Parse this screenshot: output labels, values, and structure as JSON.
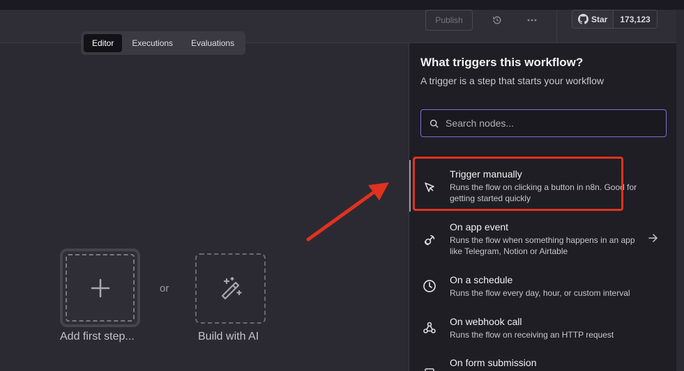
{
  "header": {
    "publish_label": "Publish",
    "history_icon": "history-icon",
    "more_icon": "more-horizontal-icon",
    "github": {
      "icon": "github-icon",
      "star_label": "Star",
      "star_count": "173,123"
    }
  },
  "tabs": [
    {
      "label": "Editor",
      "active": true
    },
    {
      "label": "Executions",
      "active": false
    },
    {
      "label": "Evaluations",
      "active": false
    }
  ],
  "canvas": {
    "add_first_step_label": "Add first step...",
    "or_label": "or",
    "build_ai_label": "Build with AI"
  },
  "panel": {
    "title": "What triggers this workflow?",
    "subtitle": "A trigger is a step that starts your workflow",
    "search": {
      "placeholder": "Search nodes...",
      "value": ""
    },
    "items": [
      {
        "icon": "cursor-icon",
        "name": "Trigger manually",
        "desc": "Runs the flow on clicking a button in n8n. Good for getting started quickly",
        "has_chevron": false
      },
      {
        "icon": "app-event-icon",
        "name": "On app event",
        "desc": "Runs the flow when something happens in an app like Telegram, Notion or Airtable",
        "has_chevron": true
      },
      {
        "icon": "clock-icon",
        "name": "On a schedule",
        "desc": "Runs the flow every day, hour, or custom interval",
        "has_chevron": false
      },
      {
        "icon": "webhook-icon",
        "name": "On webhook call",
        "desc": "Runs the flow on receiving an HTTP request",
        "has_chevron": false
      },
      {
        "icon": "form-icon",
        "name": "On form submission",
        "desc": "",
        "has_chevron": false
      }
    ]
  },
  "colors": {
    "accent": "#7c6fd6",
    "annotation": "#e0321f",
    "panel_bg": "#1f1e24",
    "canvas_bg": "#2b2a33"
  }
}
